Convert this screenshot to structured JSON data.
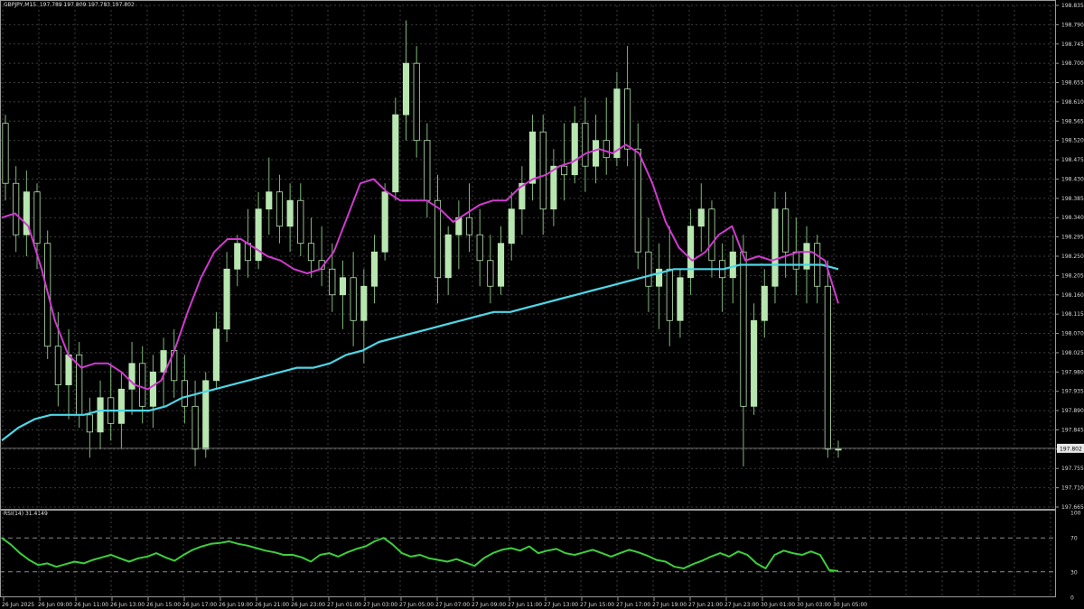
{
  "header": {
    "symbol_line": "GBPJPY,M15  197.789 197.809 197.783 197.802",
    "indicator_line": "RSI(14) 31.4149"
  },
  "price_panel": {
    "y_ticks": [
      "198.835",
      "198.790",
      "198.745",
      "198.700",
      "198.655",
      "198.610",
      "198.565",
      "198.520",
      "198.475",
      "198.430",
      "198.385",
      "198.340",
      "198.295",
      "198.250",
      "198.205",
      "198.160",
      "198.115",
      "198.070",
      "198.025",
      "197.980",
      "197.935",
      "197.890",
      "197.845",
      "197.800",
      "197.755",
      "197.710",
      "197.665"
    ],
    "current_price_label": "197.802"
  },
  "rsi_panel": {
    "y_ticks": [
      "100",
      "70",
      "30",
      "0"
    ]
  },
  "time_axis": {
    "labels": [
      "26 Jun 2025",
      "26 Jun 09:00",
      "26 Jun 11:00",
      "26 Jun 13:00",
      "26 Jun 15:00",
      "26 Jun 17:00",
      "26 Jun 19:00",
      "26 Jun 21:00",
      "26 Jun 23:00",
      "27 Jun 01:00",
      "27 Jun 03:00",
      "27 Jun 05:00",
      "27 Jun 07:00",
      "27 Jun 09:00",
      "27 Jun 11:00",
      "27 Jun 13:00",
      "27 Jun 15:00",
      "27 Jun 17:00",
      "27 Jun 19:00",
      "27 Jun 21:00",
      "27 Jun 23:00",
      "30 Jun 01:00",
      "30 Jun 03:00",
      "30 Jun 05:00"
    ]
  },
  "colors": {
    "background": "#000000",
    "grid": "#3c3c3c",
    "candle_up": "#b8e6b0",
    "candle_down": "#000000",
    "wick": "#7fb87a",
    "ma_fast": "#d03ad0",
    "ma_slow": "#4fd6e6",
    "rsi_line": "#3ccf3c",
    "axis_text": "#d8d8d8"
  },
  "chart_data": [
    {
      "type": "candlestick",
      "series_symbol": "GBPJPY",
      "timeframe": "M15",
      "ylim": [
        197.665,
        198.835
      ],
      "last_close": 197.802,
      "candles": [
        [
          198.56,
          198.58,
          198.38,
          198.42
        ],
        [
          198.42,
          198.46,
          198.26,
          198.3
        ],
        [
          198.3,
          198.45,
          198.25,
          198.4
        ],
        [
          198.4,
          198.42,
          198.22,
          198.28
        ],
        [
          198.28,
          198.31,
          198.01,
          198.04
        ],
        [
          198.04,
          198.12,
          197.9,
          197.95
        ],
        [
          197.95,
          198.08,
          197.87,
          198.02
        ],
        [
          198.02,
          198.05,
          197.85,
          197.88
        ],
        [
          197.88,
          197.92,
          197.78,
          197.84
        ],
        [
          197.84,
          197.96,
          197.8,
          197.92
        ],
        [
          197.92,
          198.0,
          197.82,
          197.86
        ],
        [
          197.86,
          197.98,
          197.8,
          197.94
        ],
        [
          197.94,
          198.05,
          197.88,
          198.0
        ],
        [
          198.0,
          198.04,
          197.86,
          197.9
        ],
        [
          197.9,
          198.02,
          197.85,
          197.98
        ],
        [
          197.98,
          198.06,
          197.9,
          198.03
        ],
        [
          198.03,
          198.08,
          197.92,
          197.96
        ],
        [
          197.96,
          198.02,
          197.86,
          197.9
        ],
        [
          197.9,
          197.96,
          197.76,
          197.8
        ],
        [
          197.8,
          197.98,
          197.78,
          197.96
        ],
        [
          197.96,
          198.12,
          197.94,
          198.08
        ],
        [
          198.08,
          198.26,
          198.05,
          198.22
        ],
        [
          198.22,
          198.3,
          198.18,
          198.28
        ],
        [
          198.28,
          198.36,
          198.2,
          198.24
        ],
        [
          198.24,
          198.4,
          198.22,
          198.36
        ],
        [
          198.36,
          198.48,
          198.3,
          198.4
        ],
        [
          198.4,
          198.44,
          198.28,
          198.32
        ],
        [
          198.32,
          198.42,
          198.26,
          198.38
        ],
        [
          198.38,
          198.42,
          198.25,
          198.28
        ],
        [
          198.28,
          198.34,
          198.2,
          198.24
        ],
        [
          198.24,
          198.32,
          198.18,
          198.22
        ],
        [
          198.22,
          198.28,
          198.12,
          198.16
        ],
        [
          198.16,
          198.24,
          198.08,
          198.2
        ],
        [
          198.2,
          198.26,
          198.04,
          198.1
        ],
        [
          198.1,
          198.22,
          198.0,
          198.18
        ],
        [
          198.18,
          198.3,
          198.14,
          198.26
        ],
        [
          198.26,
          198.42,
          198.24,
          198.4
        ],
        [
          198.4,
          198.62,
          198.38,
          198.58
        ],
        [
          198.58,
          198.8,
          198.52,
          198.7
        ],
        [
          198.7,
          198.74,
          198.48,
          198.52
        ],
        [
          198.52,
          198.56,
          198.34,
          198.38
        ],
        [
          198.38,
          198.44,
          198.14,
          198.2
        ],
        [
          198.2,
          198.32,
          198.16,
          198.3
        ],
        [
          198.3,
          198.38,
          198.22,
          198.34
        ],
        [
          198.34,
          198.42,
          198.26,
          198.3
        ],
        [
          198.3,
          198.36,
          198.18,
          198.24
        ],
        [
          198.24,
          198.3,
          198.14,
          198.18
        ],
        [
          198.18,
          198.32,
          198.16,
          198.28
        ],
        [
          198.28,
          198.4,
          198.24,
          198.36
        ],
        [
          198.36,
          198.46,
          198.3,
          198.42
        ],
        [
          198.42,
          198.58,
          198.38,
          198.54
        ],
        [
          198.54,
          198.58,
          198.3,
          198.36
        ],
        [
          198.36,
          198.5,
          198.32,
          198.46
        ],
        [
          198.46,
          198.56,
          198.38,
          198.44
        ],
        [
          198.44,
          198.6,
          198.42,
          198.56
        ],
        [
          198.56,
          198.62,
          198.4,
          198.46
        ],
        [
          198.46,
          198.58,
          198.42,
          198.52
        ],
        [
          198.52,
          198.62,
          198.44,
          198.48
        ],
        [
          198.48,
          198.68,
          198.46,
          198.64
        ],
        [
          198.64,
          198.74,
          198.46,
          198.5
        ],
        [
          198.5,
          198.56,
          198.22,
          198.26
        ],
        [
          198.26,
          198.34,
          198.12,
          198.18
        ],
        [
          198.18,
          198.28,
          198.08,
          198.22
        ],
        [
          198.22,
          198.32,
          198.04,
          198.1
        ],
        [
          198.1,
          198.22,
          198.06,
          198.2
        ],
        [
          198.2,
          198.36,
          198.16,
          198.32
        ],
        [
          198.32,
          198.42,
          198.26,
          198.36
        ],
        [
          198.36,
          198.38,
          198.2,
          198.24
        ],
        [
          198.24,
          198.28,
          198.12,
          198.2
        ],
        [
          198.2,
          198.3,
          198.14,
          198.26
        ],
        [
          198.26,
          198.3,
          197.76,
          197.9
        ],
        [
          197.9,
          198.14,
          197.88,
          198.1
        ],
        [
          198.1,
          198.22,
          198.06,
          198.18
        ],
        [
          198.18,
          198.4,
          198.14,
          198.36
        ],
        [
          198.36,
          198.4,
          198.2,
          198.26
        ],
        [
          198.26,
          198.34,
          198.16,
          198.22
        ],
        [
          198.22,
          198.32,
          198.14,
          198.28
        ],
        [
          198.28,
          198.3,
          198.14,
          198.18
        ],
        [
          198.18,
          198.24,
          197.78,
          197.8
        ],
        [
          197.8,
          197.82,
          197.78,
          197.8
        ]
      ]
    },
    {
      "type": "line",
      "name": "",
      "ylim": [
        197.665,
        198.835
      ],
      "values": [
        198.34,
        198.35,
        198.32,
        198.22,
        198.1,
        198.02,
        197.99,
        198.0,
        198.0,
        197.98,
        197.95,
        197.94,
        197.96,
        198.03,
        198.12,
        198.2,
        198.26,
        198.29,
        198.29,
        198.27,
        198.25,
        198.24,
        198.22,
        198.21,
        198.22,
        198.26,
        198.34,
        198.42,
        198.43,
        198.4,
        198.38,
        198.38,
        198.38,
        198.36,
        198.33,
        198.35,
        198.37,
        198.38,
        198.38,
        198.41,
        198.43,
        198.44,
        198.46,
        198.47,
        198.49,
        198.5,
        198.49,
        198.51,
        198.49,
        198.42,
        198.33,
        198.27,
        198.24,
        198.26,
        198.3,
        198.32,
        198.24,
        198.25,
        198.24,
        198.25,
        198.26,
        198.26,
        198.24,
        198.14
      ]
    },
    {
      "type": "line",
      "name": "",
      "ylim": [
        197.665,
        198.835
      ],
      "values": [
        197.82,
        197.85,
        197.87,
        197.88,
        197.88,
        197.88,
        197.89,
        197.89,
        197.89,
        197.89,
        197.9,
        197.92,
        197.93,
        197.94,
        197.95,
        197.96,
        197.97,
        197.98,
        197.99,
        197.99,
        198.0,
        198.02,
        198.03,
        198.05,
        198.06,
        198.07,
        198.08,
        198.09,
        198.1,
        198.11,
        198.12,
        198.12,
        198.13,
        198.14,
        198.15,
        198.16,
        198.17,
        198.18,
        198.19,
        198.2,
        198.21,
        198.22,
        198.22,
        198.22,
        198.22,
        198.23,
        198.23,
        198.23,
        198.23,
        198.23,
        198.23,
        198.22
      ]
    },
    {
      "type": "line",
      "name": "RSI(14)",
      "ylim": [
        0,
        100
      ],
      "reference_levels": [
        70,
        30
      ],
      "last_value": 31.4149,
      "values": [
        70,
        62,
        52,
        44,
        38,
        40,
        36,
        39,
        42,
        40,
        44,
        47,
        50,
        46,
        42,
        46,
        48,
        52,
        47,
        43,
        50,
        56,
        60,
        63,
        64,
        66,
        63,
        61,
        58,
        55,
        53,
        50,
        50,
        47,
        42,
        50,
        52,
        48,
        53,
        57,
        60,
        66,
        70,
        62,
        52,
        48,
        50,
        46,
        44,
        42,
        45,
        41,
        37,
        46,
        52,
        56,
        58,
        55,
        60,
        52,
        55,
        57,
        52,
        50,
        53,
        56,
        52,
        48,
        52,
        56,
        53,
        49,
        44,
        42,
        36,
        34,
        39,
        43,
        48,
        52,
        48,
        54,
        50,
        40,
        34,
        50,
        55,
        52,
        50,
        54,
        50,
        32,
        31
      ]
    }
  ]
}
